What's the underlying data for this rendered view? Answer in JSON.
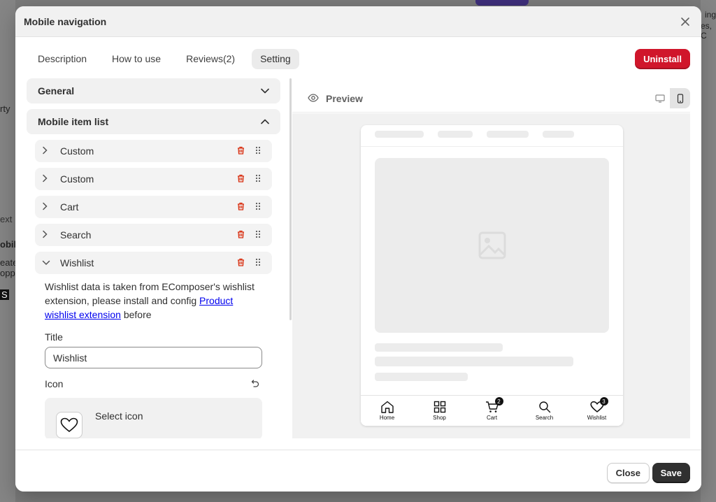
{
  "background": {
    "left_fragments": [
      "rty",
      "ext",
      "obile",
      "eate",
      "opp",
      "S"
    ],
    "right_fragments": [
      "ing",
      "es, C"
    ]
  },
  "modal": {
    "title": "Mobile navigation",
    "tabs": [
      {
        "label": "Description"
      },
      {
        "label": "How to use"
      },
      {
        "label": "Reviews(2)"
      },
      {
        "label": "Setting",
        "active": true
      }
    ],
    "uninstall_label": "Uninstall"
  },
  "settings": {
    "general_label": "General",
    "mobile_list_label": "Mobile item list",
    "items": [
      {
        "label": "Custom",
        "expanded": false
      },
      {
        "label": "Custom",
        "expanded": false
      },
      {
        "label": "Cart",
        "expanded": false
      },
      {
        "label": "Search",
        "expanded": false
      },
      {
        "label": "Wishlist",
        "expanded": true
      }
    ],
    "wishlist": {
      "desc_prefix": "Wishlist data is taken from EComposer's wishlist extension, please install and config ",
      "link_text": "Product wishlist extension",
      "desc_suffix": " before",
      "title_label": "Title",
      "title_value": "Wishlist",
      "icon_label": "Icon",
      "select_icon_label": "Select icon"
    }
  },
  "preview": {
    "label": "Preview",
    "nav": [
      {
        "label": "Home",
        "icon": "home-icon"
      },
      {
        "label": "Shop",
        "icon": "grid-icon"
      },
      {
        "label": "Cart",
        "icon": "cart-icon",
        "badge": "2"
      },
      {
        "label": "Search",
        "icon": "search-icon"
      },
      {
        "label": "Wishlist",
        "icon": "heart-icon",
        "badge": "3"
      }
    ]
  },
  "footer": {
    "close_label": "Close",
    "save_label": "Save"
  },
  "colors": {
    "danger": "#d0162b",
    "primary_dark": "#303030",
    "link": "#0000ee"
  }
}
